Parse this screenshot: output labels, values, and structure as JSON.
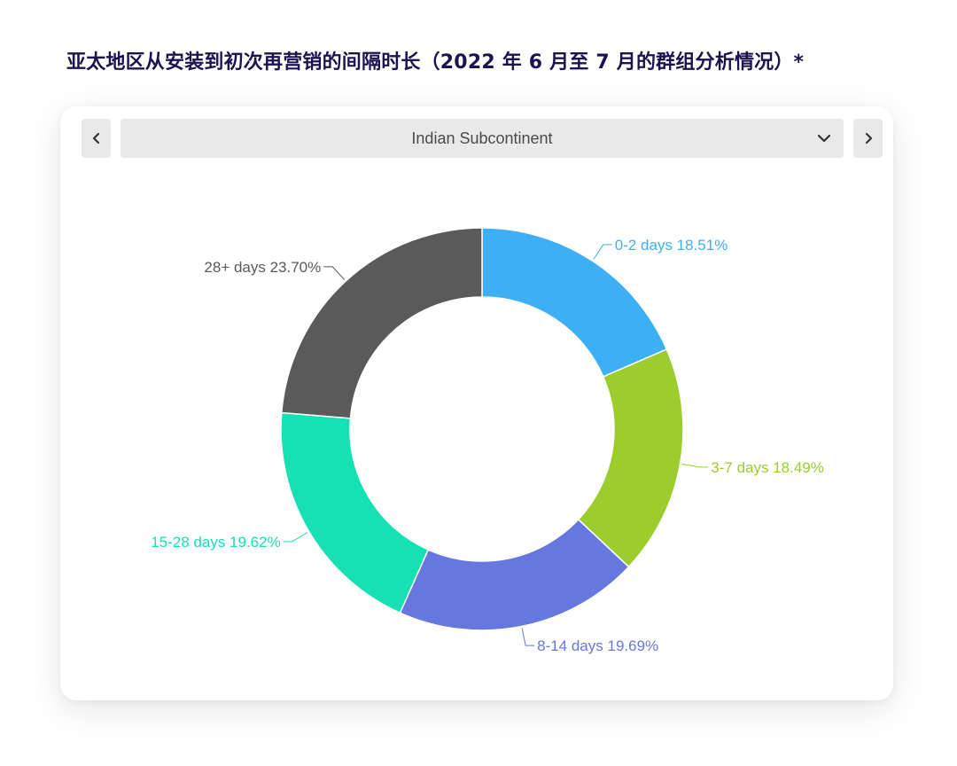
{
  "title": "亚太地区从安装到初次再营销的间隔时长（2022 年 6 月至 7 月的群组分析情况）*",
  "selector": {
    "prev_icon": "chevron-left-icon",
    "next_icon": "chevron-right-icon",
    "dropdown_icon": "chevron-down-icon",
    "selected": "Indian Subcontinent"
  },
  "chart_data": {
    "type": "pie",
    "donut": true,
    "slices": [
      {
        "category": "0-2 days",
        "value": 18.51,
        "label": "0-2 days 18.51%",
        "color": "#3db0f5"
      },
      {
        "category": "3-7 days",
        "value": 18.49,
        "label": "3-7 days 18.49%",
        "color": "#9ccc2e"
      },
      {
        "category": "8-14 days",
        "value": 19.69,
        "label": "8-14 days 19.69%",
        "color": "#6677e0"
      },
      {
        "category": "15-28 days",
        "value": 19.62,
        "label": "15-28 days 19.62%",
        "color": "#16e0b4"
      },
      {
        "category": "28+ days",
        "value": 23.7,
        "label": "28+ days 23.70%",
        "color": "#5a5a5a"
      }
    ]
  }
}
